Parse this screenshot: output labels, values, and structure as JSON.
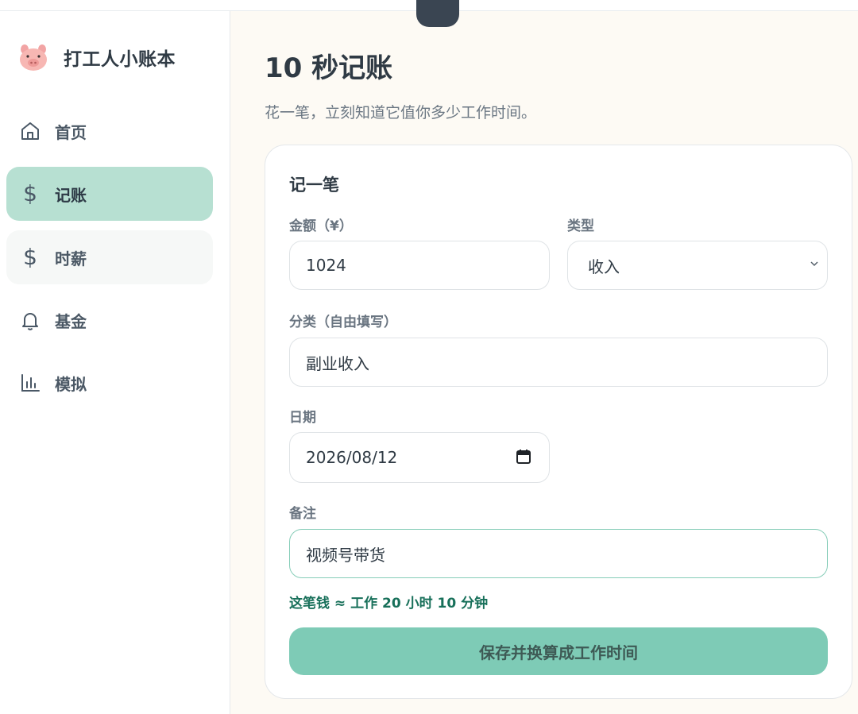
{
  "app": {
    "name": "打工人小账本"
  },
  "sidebar": {
    "items": [
      {
        "label": "首页",
        "icon": "home-icon",
        "active": false
      },
      {
        "label": "记账",
        "icon": "dollar-icon",
        "active": true
      },
      {
        "label": "时薪",
        "icon": "dollar-icon",
        "active": false
      },
      {
        "label": "基金",
        "icon": "bell-icon",
        "active": false
      },
      {
        "label": "模拟",
        "icon": "bar-chart-icon",
        "active": false
      }
    ]
  },
  "page": {
    "title": "10 秒记账",
    "subtitle": "花一笔，立刻知道它值你多少工作时间。"
  },
  "form": {
    "card_title": "记一笔",
    "amount_label": "金额（¥）",
    "amount_value": "1024",
    "type_label": "类型",
    "type_value": "收入",
    "category_label": "分类（自由填写）",
    "category_value": "副业收入",
    "date_label": "日期",
    "date_value": "2026/08/12",
    "note_label": "备注",
    "note_value": "视频号带货",
    "work_time_hint": "这笔钱 ≈ 工作 20 小时 10 分钟",
    "save_label": "保存并换算成工作时间"
  },
  "colors": {
    "accent": "#7ecbb6",
    "active_nav": "#b7e0d2",
    "hint_text": "#18705a"
  }
}
